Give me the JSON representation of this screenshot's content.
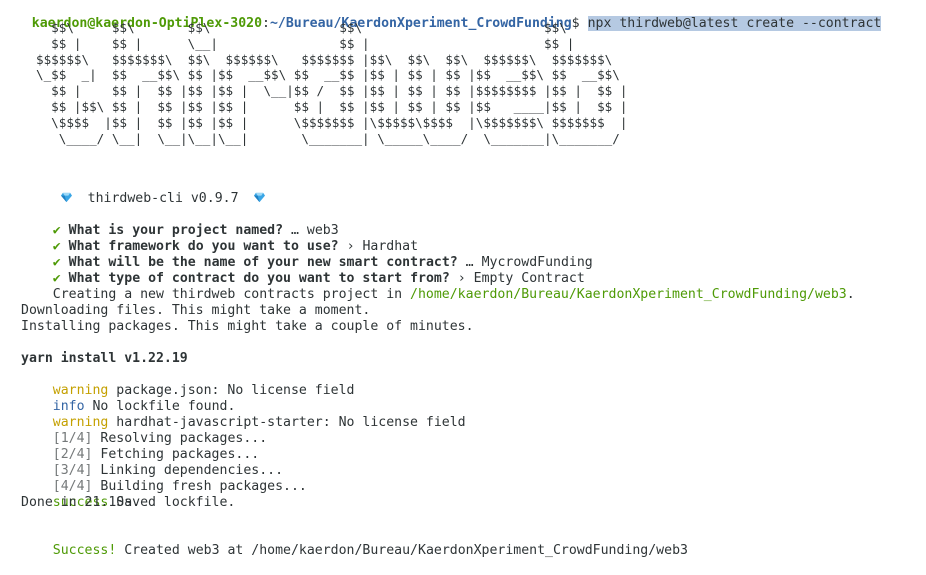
{
  "prompt": {
    "user_host": "kaerdon@kaerdon-OptiPlex-3020",
    "separator": ":",
    "path": "~/Bureau/KaerdonXperiment_CrowdFunding",
    "symbol": "$",
    "command": "npx thirdweb@latest create --contract"
  },
  "banner": {
    "ascii_art": "  $$\\     $$\\       $$\\                 $$\\                        $$\\\n  $$ |    $$ |      \\__|                $$ |                       $$ |\n$$$$$$\\   $$$$$$$\\  $$\\  $$$$$$\\   $$$$$$$ |$$\\  $$\\  $$\\  $$$$$$\\  $$$$$$$\\\n\\_$$  _|  $$  __$$\\ $$ |$$  __$$\\ $$  __$$ |$$ | $$ | $$ |$$  __$$\\ $$  __$$\\\n  $$ |    $$ |  $$ |$$ |$$ |  \\__|$$ /  $$ |$$ | $$ | $$ |$$$$$$$$ |$$ |  $$ |\n  $$ |$$\\ $$ |  $$ |$$ |$$ |      $$ |  $$ |$$ | $$ | $$ |$$   ____|$$ |  $$ |\n  \\$$$$  |$$ |  $$ |$$ |$$ |      \\$$$$$$$ |\\$$$$$\\$$$$  |\\$$$$$$$\\ $$$$$$$  |\n   \\____/ \\__|  \\__|\\__|\\__|       \\_______| \\_____\\____/  \\_______|\\_______/",
    "cli_name": "thirdweb-cli v0.9.7"
  },
  "questions": [
    {
      "check": "✔",
      "question": "What is your project named?",
      "sep": "…",
      "answer": "web3"
    },
    {
      "check": "✔",
      "question": "What framework do you want to use?",
      "sep": "›",
      "answer": "Hardhat"
    },
    {
      "check": "✔",
      "question": "What will be the name of your new smart contract?",
      "sep": "…",
      "answer": "MycrowdFunding"
    },
    {
      "check": "✔",
      "question": "What type of contract do you want to start from?",
      "sep": "›",
      "answer": "Empty Contract"
    }
  ],
  "creating": {
    "text": "Creating a new thirdweb contracts project in ",
    "path": "/home/kaerdon/Bureau/KaerdonXperiment_CrowdFunding/web3",
    "end": "."
  },
  "downloading": "Downloading files. This might take a moment.",
  "installing": "Installing packages. This might take a couple of minutes.",
  "yarn": {
    "header": "yarn install v1.22.19",
    "lines": [
      {
        "tag": "warning",
        "text": " package.json: No license field",
        "kind": "yellow"
      },
      {
        "tag": "info",
        "text": " No lockfile found.",
        "kind": "blue"
      },
      {
        "tag": "warning",
        "text": " hardhat-javascript-starter: No license field",
        "kind": "yellow"
      },
      {
        "tag": "[1/4]",
        "text": " Resolving packages...",
        "kind": "gray"
      },
      {
        "tag": "[2/4]",
        "text": " Fetching packages...",
        "kind": "gray"
      },
      {
        "tag": "[3/4]",
        "text": " Linking dependencies...",
        "kind": "gray"
      },
      {
        "tag": "[4/4]",
        "text": " Building fresh packages...",
        "kind": "gray"
      },
      {
        "tag": "success",
        "text": " Saved lockfile.",
        "kind": "green"
      }
    ],
    "done": "Done in 21.10s."
  },
  "final": {
    "tag": "Success!",
    "text": " Created web3 at /home/kaerdon/Bureau/KaerdonXperiment_CrowdFunding/web3"
  },
  "colors": {
    "background": "#ffffff",
    "foreground": "#2e3436",
    "green": "#4e9a06",
    "blue": "#3465a4",
    "yellow": "#c4a000",
    "gray": "#75797a",
    "selection": "#b5c9e2"
  },
  "icons": {
    "cli_left": "gem-icon",
    "cli_right": "gem-icon"
  }
}
